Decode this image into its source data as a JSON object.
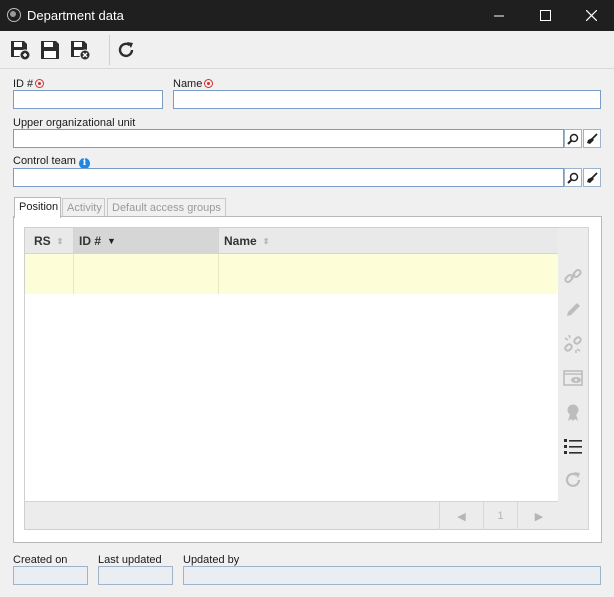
{
  "window": {
    "title": "Department data",
    "icon": "globe-icon"
  },
  "toolbar": {
    "buttons": [
      {
        "name": "save-and-new-button",
        "icon": "save-plus-icon"
      },
      {
        "name": "save-button",
        "icon": "floppy-icon"
      },
      {
        "name": "save-and-close-button",
        "icon": "save-close-icon"
      },
      {
        "name": "refresh-button",
        "icon": "refresh-icon"
      }
    ]
  },
  "form": {
    "id_label": "ID #",
    "id_value": "",
    "name_label": "Name",
    "name_value": "",
    "upper_unit_label": "Upper organizational unit",
    "upper_unit_value": "",
    "control_team_label": "Control team",
    "control_team_value": ""
  },
  "tabs": [
    {
      "label": "Position",
      "active": true
    },
    {
      "label": "Activity",
      "active": false
    },
    {
      "label": "Default access groups",
      "active": false
    }
  ],
  "grid": {
    "columns": [
      "RS",
      "ID #",
      "Name"
    ],
    "sorted_column": "ID #",
    "rows": [],
    "pager": {
      "prev": "◀",
      "page": "1",
      "next": "▶"
    }
  },
  "side_actions": [
    "link-icon",
    "edit-icon",
    "unlink-icon",
    "view-icon",
    "certificate-icon",
    "list-icon",
    "refresh-icon"
  ],
  "footer": {
    "created_on_label": "Created on",
    "created_on_value": "",
    "last_updated_label": "Last updated",
    "last_updated_value": "",
    "updated_by_label": "Updated by",
    "updated_by_value": ""
  },
  "colors": {
    "titlebar": "#1f1f1f",
    "required_marker": "#d32f2f",
    "info_icon": "#1e88e5",
    "selected_row": "#fdfdd8"
  }
}
